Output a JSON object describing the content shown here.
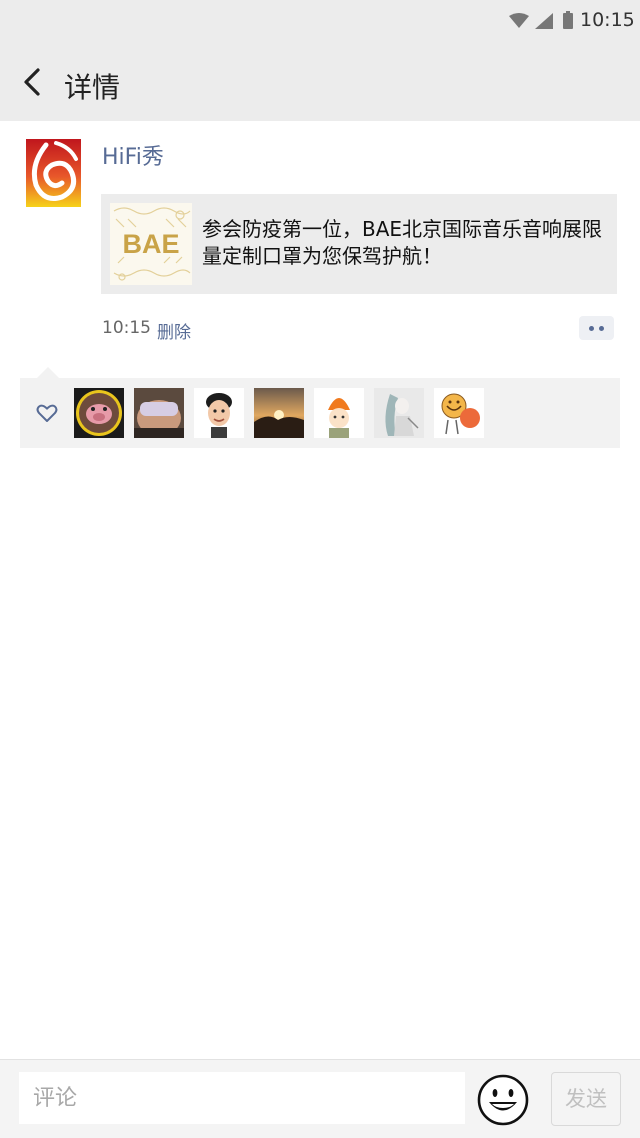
{
  "status_bar": {
    "time": "10:15"
  },
  "header": {
    "title": "详情"
  },
  "post": {
    "poster_name": "HiFi秀",
    "link_card": {
      "thumb_text": "BAE",
      "text": "参会防疫第一位，BAE北京国际音乐音响展限量定制口罩为您保驾护航！"
    },
    "time": "10:15",
    "delete_label": "删除"
  },
  "likes": {
    "avatars": [
      "pig-avatar",
      "sleeping-person-avatar",
      "cartoon-boy-avatar",
      "sunset-avatar",
      "orange-hat-girl-avatar",
      "anime-figure-avatar",
      "smiley-mascot-avatar"
    ]
  },
  "comment_bar": {
    "placeholder": "评论",
    "send_label": "发送"
  },
  "colors": {
    "link_blue": "#576b95",
    "bar_gray": "#ececec",
    "likes_gray": "#f2f2f2"
  }
}
